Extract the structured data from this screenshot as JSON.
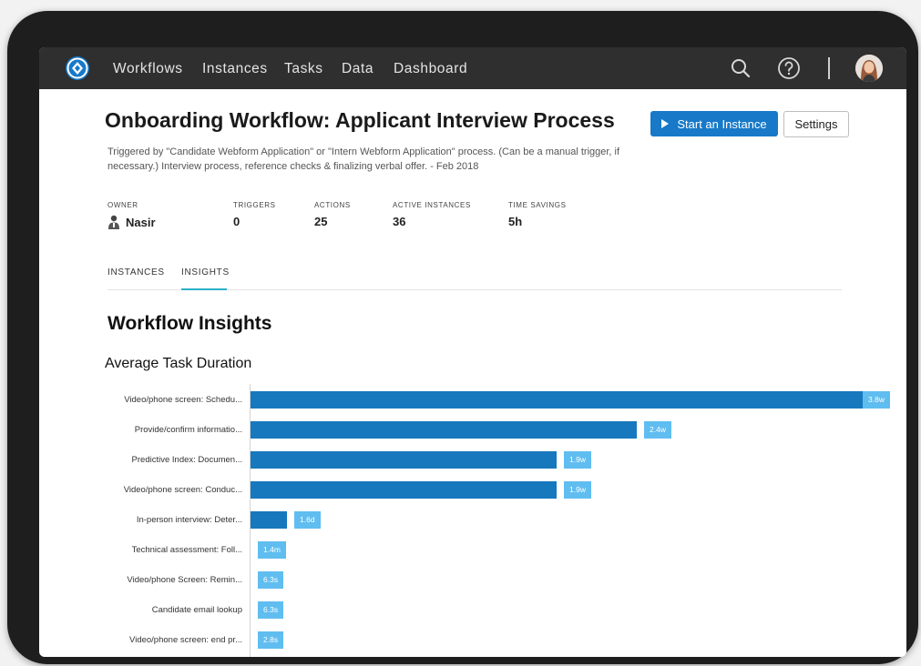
{
  "nav": {
    "items": [
      "Workflows",
      "Instances",
      "Tasks",
      "Data",
      "Dashboard"
    ],
    "icons": [
      "search-icon",
      "help-icon",
      "avatar"
    ]
  },
  "header": {
    "title": "Onboarding Workflow: Applicant Interview Process",
    "start_label": "Start an Instance",
    "settings_label": "Settings",
    "description": "Triggered by \"Candidate Webform Application\" or \"Intern Webform Application\" process. (Can be a manual trigger, if necessary.) Interview process, reference checks & finalizing verbal offer. - Feb 2018"
  },
  "stats": {
    "owner": {
      "label": "OWNER",
      "value": "Nasir"
    },
    "triggers": {
      "label": "TRIGGERS",
      "value": "0"
    },
    "actions": {
      "label": "ACTIONS",
      "value": "25"
    },
    "active": {
      "label": "ACTIVE INSTANCES",
      "value": "36"
    },
    "savings": {
      "label": "TIME SAVINGS",
      "value": "5h"
    }
  },
  "tabs": [
    {
      "label": "INSTANCES",
      "active": false
    },
    {
      "label": "INSIGHTS",
      "active": true
    }
  ],
  "insights": {
    "heading": "Workflow Insights",
    "chart_title": "Average Task Duration"
  },
  "colors": {
    "accent": "#1779c8",
    "bar": "#1778bd",
    "label": "#60bdf0",
    "tab_underline": "#2bb0c8",
    "nav": "#2f2f2f"
  },
  "chart_data": {
    "type": "bar",
    "orientation": "horizontal",
    "title": "Average Task Duration",
    "unit": "days",
    "categories": [
      "Video/phone screen: Schedu...",
      "Provide/confirm informatio...",
      "Predictive Index: Documen...",
      "Video/phone screen: Conduc...",
      "In-person interview: Deter...",
      "Technical assessment: Foll...",
      "Video/phone Screen: Remin...",
      "Candidate email lookup",
      "Video/phone screen: end pr..."
    ],
    "labels": [
      "3.8w",
      "2.4w",
      "1.9w",
      "1.9w",
      "1.6d",
      "1.4m",
      "6.3s",
      "6.3s",
      "2.8s"
    ],
    "values": [
      26.6,
      16.8,
      13.3,
      13.3,
      1.6,
      0.000972,
      7.29e-05,
      7.29e-05,
      3.24e-05
    ]
  }
}
